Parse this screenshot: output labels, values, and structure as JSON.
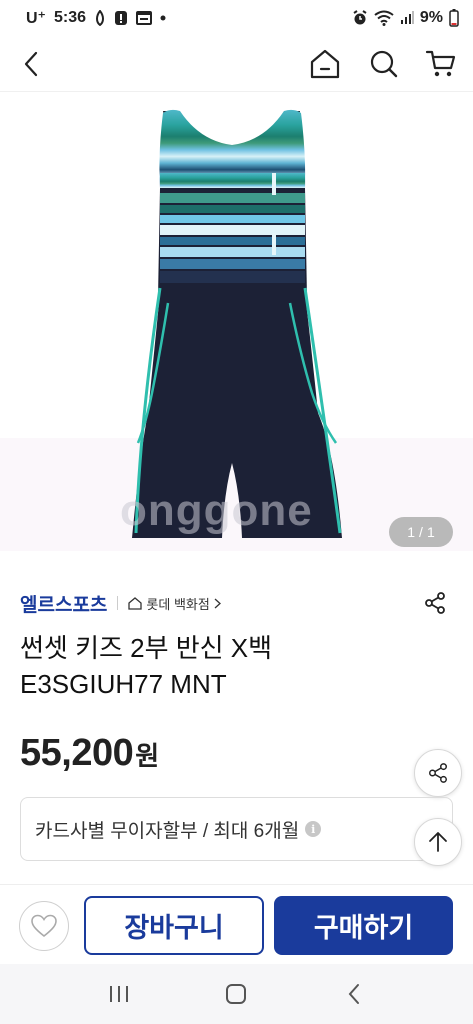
{
  "status_bar": {
    "carrier": "U⁺",
    "time": "5:36",
    "battery": "9%"
  },
  "gallery": {
    "watermark": "onggone",
    "page_current": "1",
    "page_separator": "/",
    "page_total": "1"
  },
  "product": {
    "brand": "엘르스포츠",
    "store": "롯데 백화점",
    "title_line1": "썬셋 키즈 2부 반신 X백",
    "title_line2": "E3SGIUH77 MNT",
    "price": "55,200",
    "price_unit": "원",
    "installment": "카드사별 무이자할부 / 최대 6개월"
  },
  "actions": {
    "cart_label": "장바구니",
    "buy_label": "구매하기"
  },
  "colors": {
    "brand_blue": "#1a3b9c",
    "text": "#222222"
  },
  "icons": {
    "back": "chevron-left-icon",
    "home": "home-icon",
    "search": "search-icon",
    "cart": "cart-icon",
    "share": "share-icon",
    "scroll_top": "arrow-up-icon",
    "wishlist": "heart-icon",
    "info": "info-icon"
  }
}
